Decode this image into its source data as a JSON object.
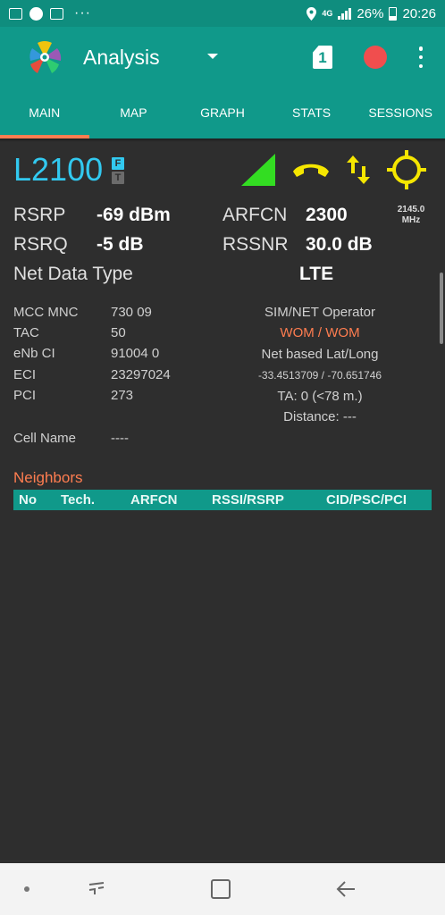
{
  "status_bar": {
    "battery": "26%",
    "time": "20:26",
    "network": "4G",
    "dots": "···"
  },
  "app_bar": {
    "title": "Analysis",
    "sim_number": "1"
  },
  "tabs": [
    {
      "label": "MAIN",
      "active": true
    },
    {
      "label": "MAP"
    },
    {
      "label": "GRAPH"
    },
    {
      "label": "STATS"
    },
    {
      "label": "SESSIONS"
    }
  ],
  "cell": {
    "tech": "L2100",
    "badge_f": "F",
    "badge_t": "T",
    "rsrp_label": "RSRP",
    "rsrp_value": "-69 dBm",
    "rsrq_label": "RSRQ",
    "rsrq_value": "-5 dB",
    "arfcn_label": "ARFCN",
    "arfcn_value": "2300",
    "freq_value": "2145.0",
    "freq_unit": "MHz",
    "rssnr_label": "RSSNR",
    "rssnr_value": "30.0 dB",
    "net_type_label": "Net Data Type",
    "net_type_value": "LTE"
  },
  "details": {
    "mcc_mnc_label": "MCC MNC",
    "mcc_mnc_value": "730 09",
    "tac_label": "TAC",
    "tac_value": "50",
    "enb_label": "eNb CI",
    "enb_value": "91004 0",
    "eci_label": "ECI",
    "eci_value": "23297024",
    "pci_label": "PCI",
    "pci_value": "273",
    "cell_name_label": "Cell Name",
    "cell_name_value": "----",
    "operator_label": "SIM/NET Operator",
    "operator_value": "WOM / WOM",
    "latlong_label": "Net based Lat/Long",
    "latlong_value": "-33.4513709 / -70.651746",
    "ta": "TA: 0 (<78 m.)",
    "distance": "Distance: ---"
  },
  "neighbors": {
    "title": "Neighbors",
    "columns": [
      "No",
      "Tech.",
      "ARFCN",
      "RSSI/RSRP",
      "CID/PSC/PCI"
    ]
  },
  "colors": {
    "accent": "#10998a",
    "highlight": "#ff7d50",
    "tech_blue": "#32c9f0",
    "signal_green": "#33dd22",
    "icon_yellow": "#f5e600",
    "record_red": "#f04e4e"
  }
}
